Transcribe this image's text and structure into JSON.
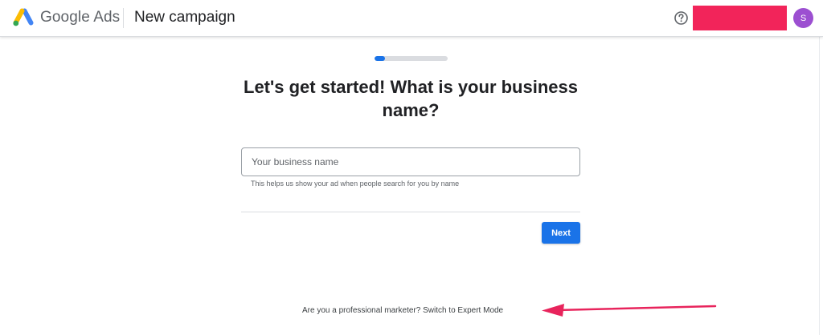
{
  "header": {
    "brand": "Google Ads",
    "page_title": "New campaign",
    "avatar_initial": "S"
  },
  "progress": {
    "fraction": 0.14
  },
  "main": {
    "heading": "Let's get started! What is your business name?",
    "business_name_input": {
      "value": "",
      "placeholder": "Your business name"
    },
    "helper_text": "This helps us show your ad when people search for you by name",
    "next_label": "Next"
  },
  "footer": {
    "question": "Are you a professional marketer?",
    "expert_mode_link": "Switch to Expert Mode"
  },
  "colors": {
    "accent": "#1a73e8",
    "annotation": "#e8245c",
    "redaction": "#f2245a",
    "avatar": "#9c4fd1"
  },
  "icons": {
    "logo": "google-ads-logo",
    "help": "help-circle-icon"
  }
}
